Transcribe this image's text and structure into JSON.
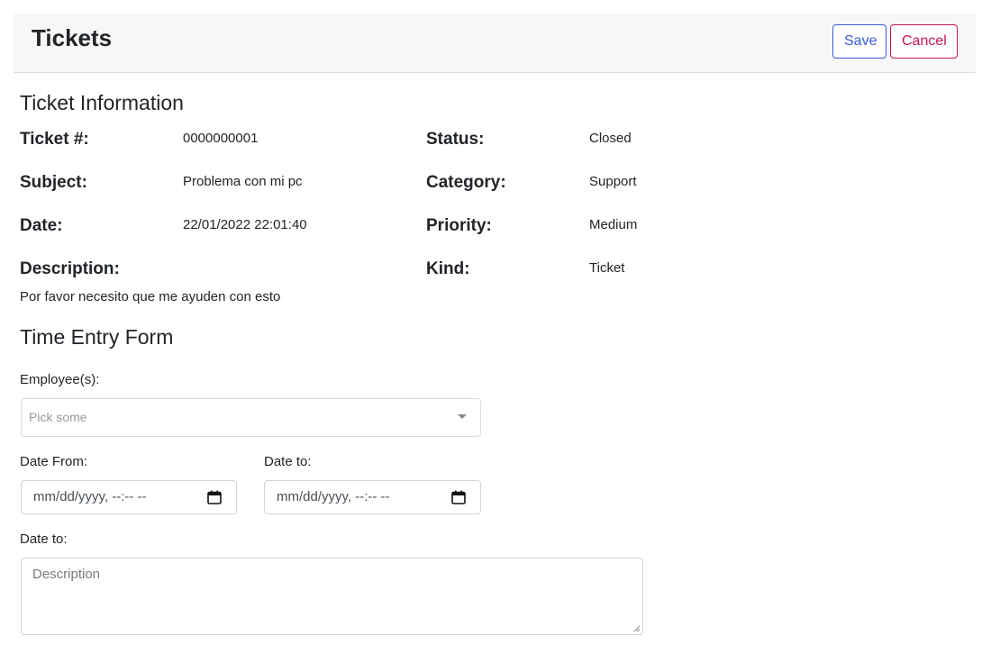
{
  "header": {
    "title": "Tickets",
    "save_label": "Save",
    "cancel_label": "Cancel"
  },
  "ticket_info": {
    "section_title": "Ticket Information",
    "ticket_number_label": "Ticket #:",
    "ticket_number_value": "0000000001",
    "subject_label": "Subject:",
    "subject_value": "Problema con mi pc",
    "date_label": "Date:",
    "date_value": "22/01/2022 22:01:40",
    "description_label": "Description:",
    "description_value": "Por favor necesito que me ayuden con esto",
    "status_label": "Status:",
    "status_value": "Closed",
    "category_label": "Category:",
    "category_value": "Support",
    "priority_label": "Priority:",
    "priority_value": "Medium",
    "kind_label": "Kind:",
    "kind_value": "Ticket"
  },
  "time_entry": {
    "section_title": "Time Entry Form",
    "employees_label": "Employee(s):",
    "employees_placeholder": "Pick some",
    "date_from_label": "Date From:",
    "date_from_value": "mm/dd/yyyy, --:-- --",
    "date_to_label": "Date to:",
    "date_to_value": "mm/dd/yyyy, --:-- --",
    "description_label": "Date to:",
    "description_placeholder": "Description"
  },
  "colors": {
    "save": "#3a5bd9",
    "cancel": "#c8174a",
    "header_bg": "#f7f7f7"
  },
  "icons": {
    "employees_select": "chevron-down-icon",
    "date_picker": "calendar-icon",
    "textarea_resize": "resize-handle-icon"
  }
}
